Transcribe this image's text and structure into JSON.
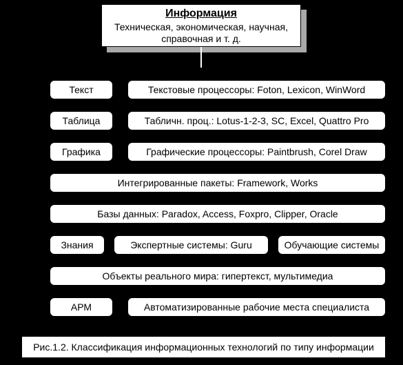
{
  "header": {
    "title": "Информация",
    "subtitle": "Техническая, экономическая, научная, справочная и т. д."
  },
  "rows": {
    "r1_left": "Текст",
    "r1_right": "Текстовые процессоры: Foton, Lexicon, WinWord",
    "r2_left": "Таблица",
    "r2_right": "Табличн. проц.: Lotus-1-2-3, SC, Excel, Quattro Pro",
    "r3_left": "Графика",
    "r3_right": "Графические процессоры: Paintbrush, Corel Draw",
    "r4": "Интегрированные пакеты: Framework, Works",
    "r5": "Базы данных: Paradox, Access, Foxpro, Clipper, Oracle",
    "r6_left": "Знания",
    "r6_mid": "Экспертные системы: Guru",
    "r6_right": "Обучающие системы",
    "r7": "Объекты реального мира: гипертекст, мультимедиа",
    "r8_left": "АРМ",
    "r8_right": "Автоматизированные рабочие места специалиста"
  },
  "caption": "Рис.1.2. Классификация информационных технологий по типу информации"
}
